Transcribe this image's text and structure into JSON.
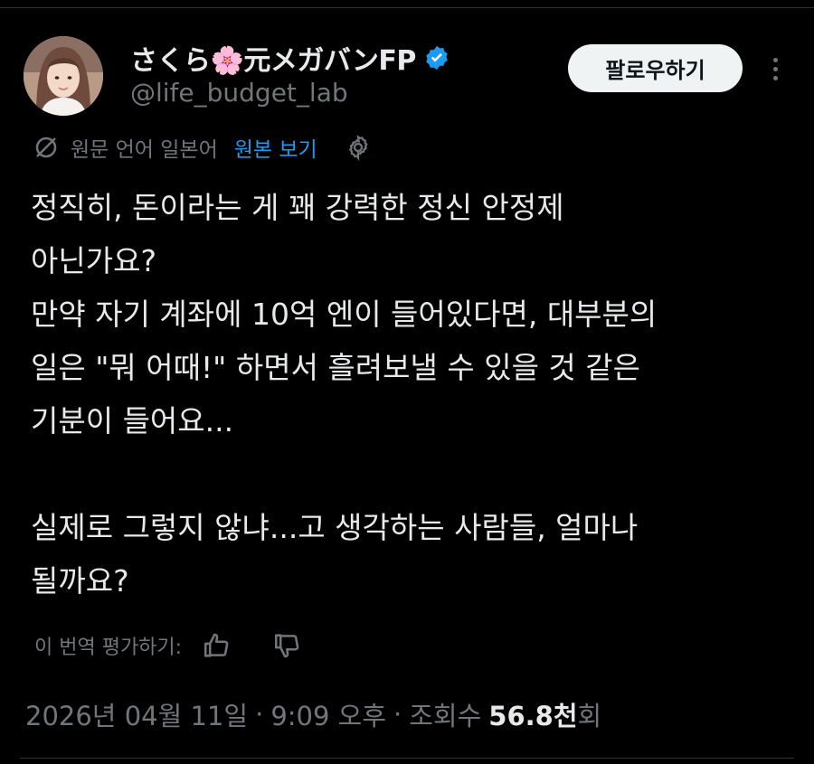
{
  "author": {
    "display_name": "さくら🌸元メガバンFP",
    "handle": "@life_budget_lab",
    "verified": true,
    "avatar_icon": "profile-photo"
  },
  "actions": {
    "follow_label": "팔로우하기",
    "more_icon": "more-dots-icon"
  },
  "translation": {
    "icon": "translate-icon",
    "language_note": "원문 언어 일본어",
    "view_original_label": "원본 보기",
    "settings_icon": "gear-icon"
  },
  "tweet": {
    "lines": [
      "정직히, 돈이라는 게 꽤 강력한 정신 안정제",
      "아닌가요?",
      "만약 자기 계좌에 10억 엔이 들어있다면, 대부분의",
      "일은 \"뭐 어때!\" 하면서 흘려보낼 수 있을 것 같은",
      "기분이 들어요...",
      "",
      "실제로 그렇지 않냐...고 생각하는 사람들, 얼마나",
      "될까요?"
    ]
  },
  "rating": {
    "label": "이 번역 평가하기:",
    "thumb_up_icon": "thumb-up-icon",
    "thumb_down_icon": "thumb-down-icon"
  },
  "meta": {
    "date": "2026년 04월 11일",
    "separator": "·",
    "time": "9:09 오후",
    "views_prefix": "조회수",
    "views_count": "56.8천",
    "views_suffix": "회"
  },
  "colors": {
    "background": "#000000",
    "text_primary": "#e7e9ea",
    "text_secondary": "#71767b",
    "accent": "#1d9bf0",
    "follow_bg": "#eff3f4"
  }
}
